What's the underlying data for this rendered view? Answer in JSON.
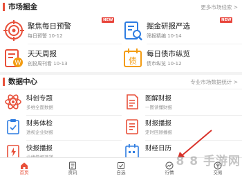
{
  "market": {
    "title": "市场掘金",
    "more": "更多市场线索 >",
    "items": [
      {
        "name": "聚焦每日预警",
        "sub": "每日预警 10-12",
        "badge": "NEW"
      },
      {
        "name": "掘金研报严选",
        "sub": "筛报精编 10-14",
        "badge": "NEW"
      },
      {
        "name": "天天周报",
        "sub": "创投周刊看 10-13"
      },
      {
        "name": "每日债市纵览",
        "sub": "债市纵览 10-12"
      }
    ]
  },
  "data_center": {
    "title": "数据中心",
    "more": "专业市场数据统计 >",
    "items": [
      {
        "name": "科创专题",
        "sub": "多维全面数据"
      },
      {
        "name": "图解财报",
        "sub": "一图读懂财报"
      },
      {
        "name": "财务体检",
        "sub": "透视企业财报"
      },
      {
        "name": "财报播报",
        "sub": "定时回顾播报"
      },
      {
        "name": "快报播报",
        "sub": "业绩快报速递"
      },
      {
        "name": "财经日历",
        "sub": ""
      }
    ]
  },
  "tabbar": {
    "items": [
      {
        "label": "首页",
        "icon": "home-icon"
      },
      {
        "label": "资讯",
        "icon": "news-icon"
      },
      {
        "label": "自选",
        "icon": "watchlist-icon"
      },
      {
        "label": "行情",
        "icon": "market-icon"
      },
      {
        "label": "交易",
        "icon": "trade-icon"
      }
    ],
    "active_index": 0
  },
  "watermark": "8 8 手游网",
  "colors": {
    "accent": "#e8503a",
    "blue": "#2f7de1",
    "orange": "#f39c12"
  }
}
